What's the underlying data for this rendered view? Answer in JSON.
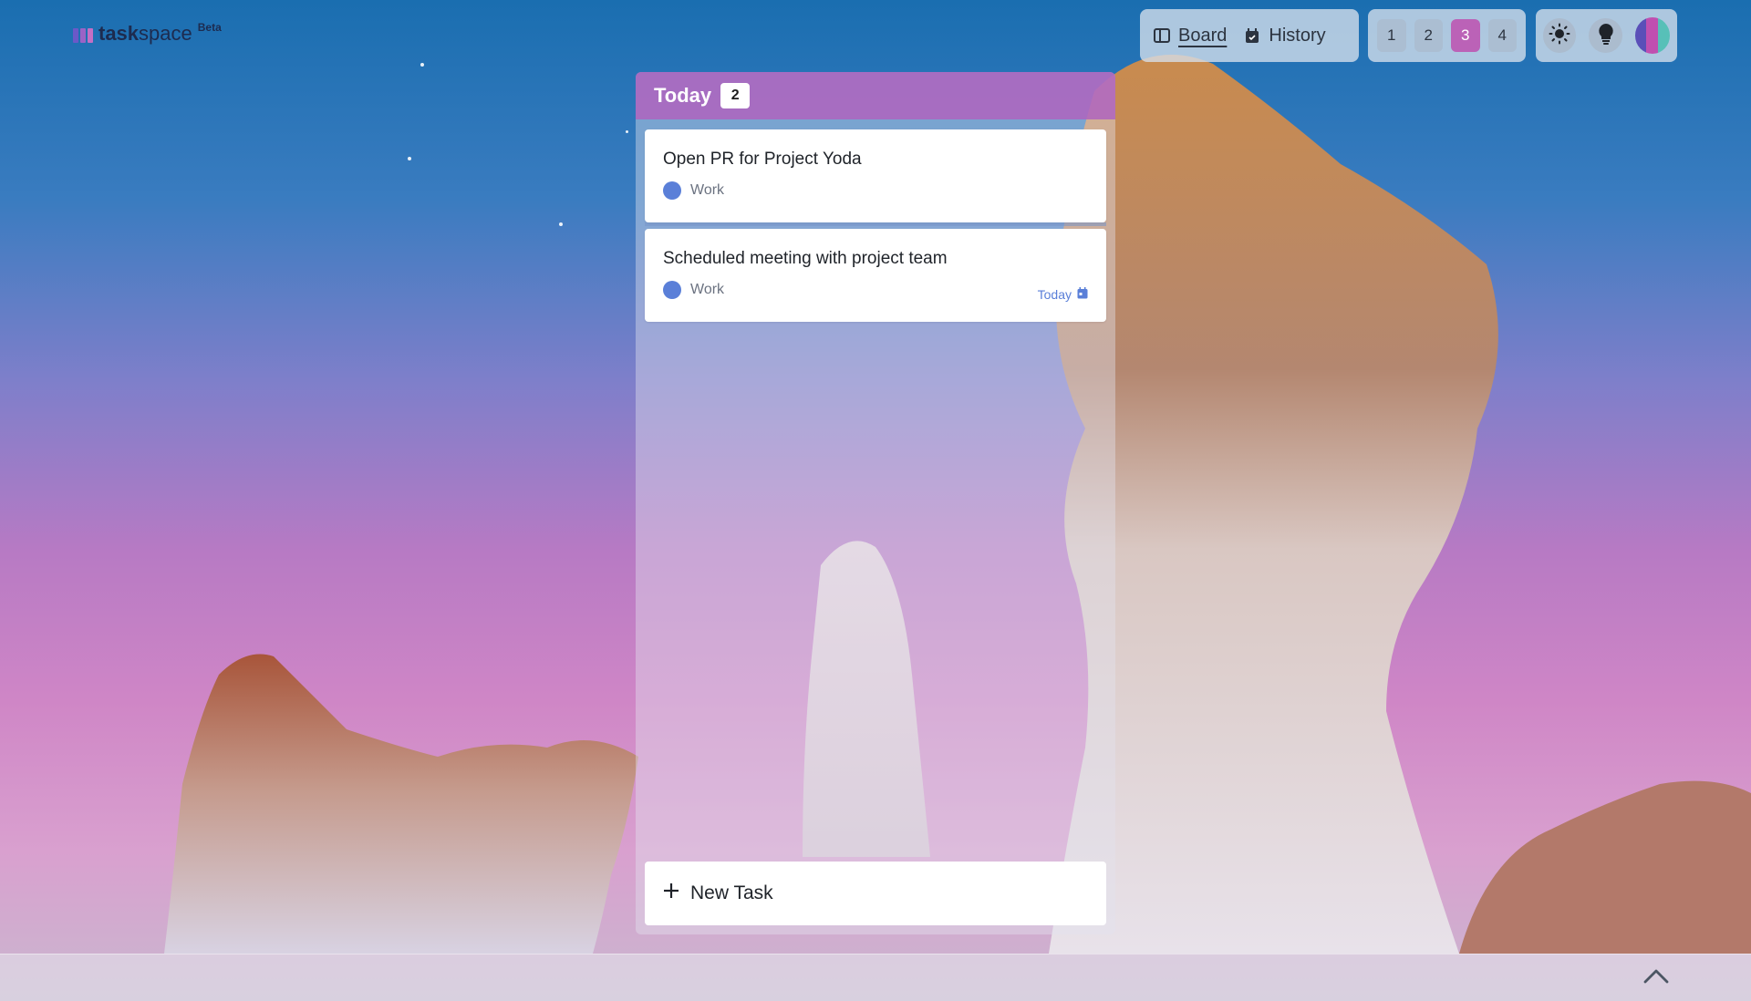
{
  "app": {
    "logo_text_bold": "task",
    "logo_text_light": "space",
    "beta_label": "Beta"
  },
  "views": [
    {
      "label": "Board",
      "icon": "board-icon",
      "active": true
    },
    {
      "label": "History",
      "icon": "calendar-icon",
      "active": false
    }
  ],
  "pages": [
    "1",
    "2",
    "3",
    "4"
  ],
  "active_page": "3",
  "actions": {
    "theme": "sun-icon",
    "ideas": "lightbulb-icon",
    "avatar": "avatar"
  },
  "column": {
    "title": "Today",
    "count": "2",
    "header_color": "#af64be"
  },
  "cards": [
    {
      "title": "Open PR for Project Yoda",
      "tag": "Work",
      "tag_color": "#5a7fd8",
      "due": ""
    },
    {
      "title": "Scheduled meeting with project team",
      "tag": "Work",
      "tag_color": "#5a7fd8",
      "due": "Today"
    }
  ],
  "new_task_label": "New Task",
  "colors": {
    "accent": "#bb62b7",
    "tag_blue": "#5a7fd8"
  }
}
